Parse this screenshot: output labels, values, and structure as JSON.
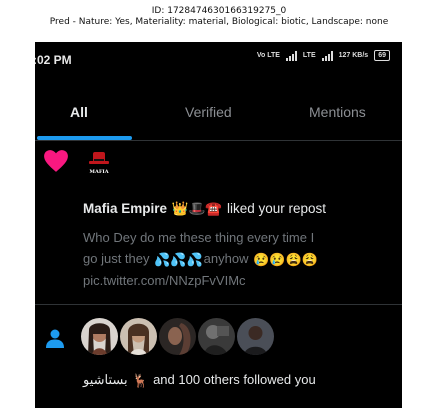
{
  "caption": {
    "line1": "ID: 1728474630166319275_0",
    "line2": "Pred - Nature: Yes, Materiality: material, Biological: biotic, Landscape: none"
  },
  "status_bar": {
    "time": ":02 PM",
    "network1": "Vo LTE",
    "network2": "LTE",
    "speed": "127 KB/s",
    "battery": "69"
  },
  "tabs": [
    {
      "label": "All",
      "active": true
    },
    {
      "label": "Verified",
      "active": false
    },
    {
      "label": "Mentions",
      "active": false
    }
  ],
  "notification_like": {
    "avatar_text": "MAFIA",
    "account_name": "Mafia Empire",
    "name_emojis": "👑🎩☎️",
    "action_text": " liked your repost",
    "body_line1": "Who Dey do me these thing every time I",
    "body_line2a": "go just they ",
    "body_line2_emojis": "💦💦💦",
    "body_line2b": "anyhow ",
    "body_line2_emojis_end": "😢😢😩😩",
    "body_line3": "pic.twitter.com/NNzpFvVIMc"
  },
  "notification_follow": {
    "name": "بستاشيو",
    "name_emoji": "🦌",
    "text": " and 100 others followed you"
  },
  "colors": {
    "accent": "#1d9bf0",
    "heart": "#f91880",
    "background": "#000000",
    "text_primary": "#e7e9ea",
    "text_secondary": "#71767b"
  }
}
